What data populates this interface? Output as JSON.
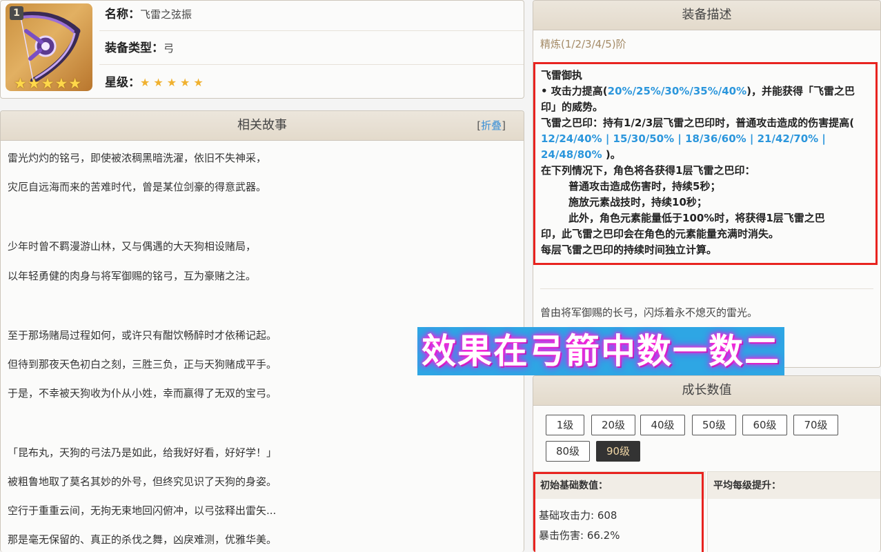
{
  "info": {
    "refine_level": "1",
    "name_label": "名称：",
    "name_value": "飞雷之弦振",
    "type_label": "装备类型：",
    "type_value": "弓",
    "rarity_label": "星级：",
    "rarity_stars": "★★★★★",
    "image_stars": "★★★★★"
  },
  "story": {
    "title": "相关故事",
    "fold_open": "[",
    "fold_label": "折叠",
    "fold_close": "]",
    "lines": [
      "雷光灼灼的铭弓，即使被浓稠黑暗洗濯，依旧不失神采，",
      "灾厄自远海而来的苦难时代，曾是某位剑豪的得意武器。",
      "少年时曾不羁漫游山林，又与偶遇的大天狗相设赌局，",
      "以年轻勇健的肉身与将军御赐的铭弓，互为豪赌之注。",
      "至于那场赌局过程如何，或许只有酣饮畅醉时才依稀记起。",
      "但待到那夜天色初白之刻，三胜三负，正与天狗赌成平手。",
      "于是，不幸被天狗收为仆从小姓，幸而赢得了无双的宝弓。",
      "「昆布丸，天狗的弓法乃是如此，给我好好看，好好学！」",
      "被粗鲁地取了莫名其妙的外号，但终究见识了天狗的身姿。",
      "空行于重重云间，无拘无束地回闪俯冲，以弓弦释出雷矢...",
      "那是毫无保留的、真正的杀伐之舞，凶戾难测，优雅华美。"
    ]
  },
  "description": {
    "title": "装备描述",
    "refine_label": "精炼(1/2/3/4/5)阶",
    "effect_title": "飞雷御执",
    "bullet_prefix": "• 攻击力提高(",
    "bullet_values": "20%/25%/30%/35%/40%",
    "bullet_suffix": ")，并能获得「飞雷之巴印」的威势。",
    "seal_prefix": "飞雷之巴印：持有1/2/3层飞雷之巴印时，普通攻击造成的伤害提高(",
    "seal_values": " 12/24/40% | 15/30/50% | 18/36/60% | 21/42/70% | 24/48/80% ",
    "seal_suffix": ")。",
    "cond_title": "在下列情况下，角色将各获得1层飞雷之巴印：",
    "cond_1": "普通攻击造成伤害时，持续5秒；",
    "cond_2": "施放元素战技时，持续10秒；",
    "cond_3_indent": "此外，角色元素能量低于100%时，将获得1层飞雷之巴",
    "cond_3_rest": "印，此飞雷之巴印会在角色的元素能量充满时消失。",
    "footer": "每层飞雷之巴印的持续时间独立计算。",
    "flavor": "曾由将军御赐的长弓，闪烁着永不熄灭的雷光。"
  },
  "banner": {
    "text": "效果在弓箭中数一数二"
  },
  "growth": {
    "title": "成长数值",
    "levels": [
      "1级",
      "20级",
      "40级",
      "50级",
      "60级",
      "70级",
      "80级",
      "90级"
    ],
    "active_level": "90级",
    "base_header": "初始基础数值：",
    "avg_header": "平均每级提升：",
    "atk_line": "基础攻击力: 608",
    "crit_line": "暴击伤害: 66.2%"
  },
  "colors": {
    "highlight_blue": "#2b96dc",
    "red_box": "#e8231f",
    "star_gold": "#f0b12f",
    "banner_bg": "#2ea6e4"
  }
}
